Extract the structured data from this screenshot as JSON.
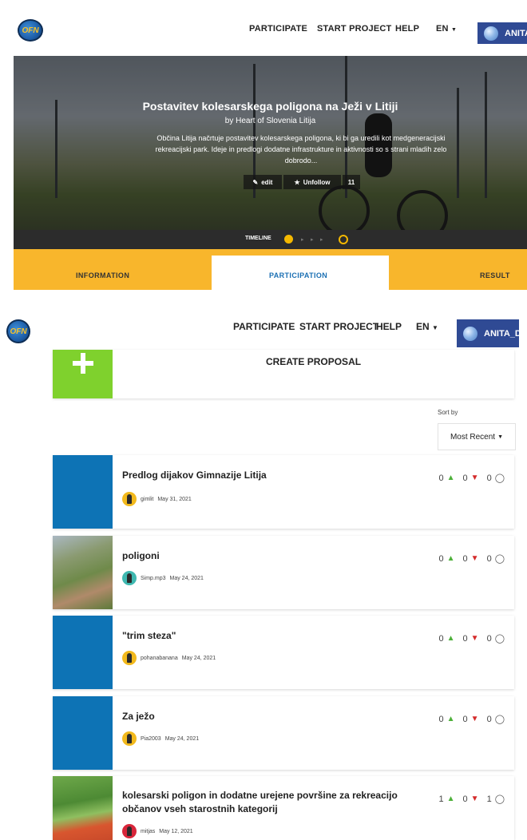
{
  "header": {
    "logo": "OFN",
    "nav": [
      "PARTICIPATE",
      "START PROJECT",
      "HELP",
      "EN"
    ],
    "user": "ANITA",
    "user2": "ANITA_DO"
  },
  "hero": {
    "title": "Postavitev kolesarskega poligona na Ježi v Litiji",
    "subtitle": "by Heart of Slovenia Litija",
    "description": "Občina Litija načrtuje postavitev kolesarskega poligona, ki bi ga uredili kot medgeneracijski rekreacijski park. Ideje in predlogi dodatne infrastrukture in aktivnosti so s strani mladih zelo dobrodo...",
    "edit_label": "edit",
    "unfollow_label": "Unfollow",
    "followers": "11",
    "timeline_label": "TIMELINE"
  },
  "tabs": [
    "INFORMATION",
    "PARTICIPATION",
    "RESULT"
  ],
  "create_label": "CREATE PROPOSAL",
  "sort": {
    "label": "Sort by",
    "value": "Most Recent"
  },
  "proposals": [
    {
      "title": "Predlog dijakov Gimnazije Litija",
      "user": "gimlit",
      "date": "May 31, 2021",
      "up": "0",
      "down": "0",
      "comments": "0"
    },
    {
      "title": "poligoni",
      "user": "Simp.mp3",
      "date": "May 24, 2021",
      "up": "0",
      "down": "0",
      "comments": "0"
    },
    {
      "title": "\"trim steza\"",
      "user": "pohanabanana",
      "date": "May 24, 2021",
      "up": "0",
      "down": "0",
      "comments": "0"
    },
    {
      "title": "Za ježo",
      "user": "Pia2003",
      "date": "May 24, 2021",
      "up": "0",
      "down": "0",
      "comments": "0"
    },
    {
      "title": "kolesarski poligon in dodatne urejene površine za rekreacijo občanov vseh starostnih kategorij",
      "user": "mitjas",
      "date": "May 12, 2021",
      "up": "1",
      "down": "0",
      "comments": "1"
    }
  ],
  "colors": {
    "accent_yellow": "#f8b62c",
    "brand_blue": "#2f4a94",
    "thumb_blue": "#0d73b5",
    "create_green": "#7fd12d",
    "upvote": "#4cb038",
    "downvote": "#d42a2a"
  }
}
